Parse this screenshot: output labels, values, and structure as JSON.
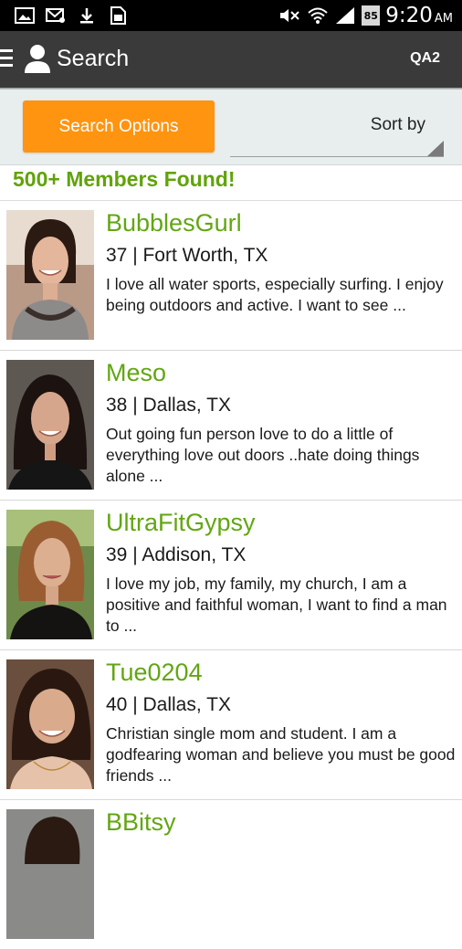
{
  "status_bar": {
    "icons_left": [
      "image-icon",
      "mail-icon",
      "download-icon",
      "sim-icon"
    ],
    "icons_right": [
      "mute-icon",
      "wifi-icon",
      "signal-icon"
    ],
    "battery": "85",
    "time": "9:20",
    "ampm": "AM"
  },
  "action_bar": {
    "title": "Search",
    "right_label": "QA2"
  },
  "options": {
    "search_options_label": "Search Options",
    "sort_by_label": "Sort by"
  },
  "results": {
    "count_text": "500+ Members Found!"
  },
  "members": [
    {
      "name": "BubblesGurl",
      "meta": "37 | Fort Worth, TX",
      "bio": "I love all water sports, especially surfing. I enjoy being outdoors and active. I want to see ..."
    },
    {
      "name": "Meso",
      "meta": "38 | Dallas, TX",
      "bio": "Out going fun person love to do a little of everything love out doors ..hate doing things alone ..."
    },
    {
      "name": "UltraFitGypsy",
      "meta": "39 | Addison, TX",
      "bio": "I love my job, my family, my church, I am a positive and faithful woman, I want to find a man to ..."
    },
    {
      "name": "Tue0204",
      "meta": "40 | Dallas, TX",
      "bio": "Christian single mom and student. I am a godfearing woman and believe you must be good friends ..."
    },
    {
      "name": "BBitsy",
      "meta": "",
      "bio": ""
    }
  ],
  "colors": {
    "accent_green": "#62a612",
    "button_orange": "#ff9410",
    "action_bar": "#3a3a3a",
    "options_bg": "#e8eeee"
  }
}
